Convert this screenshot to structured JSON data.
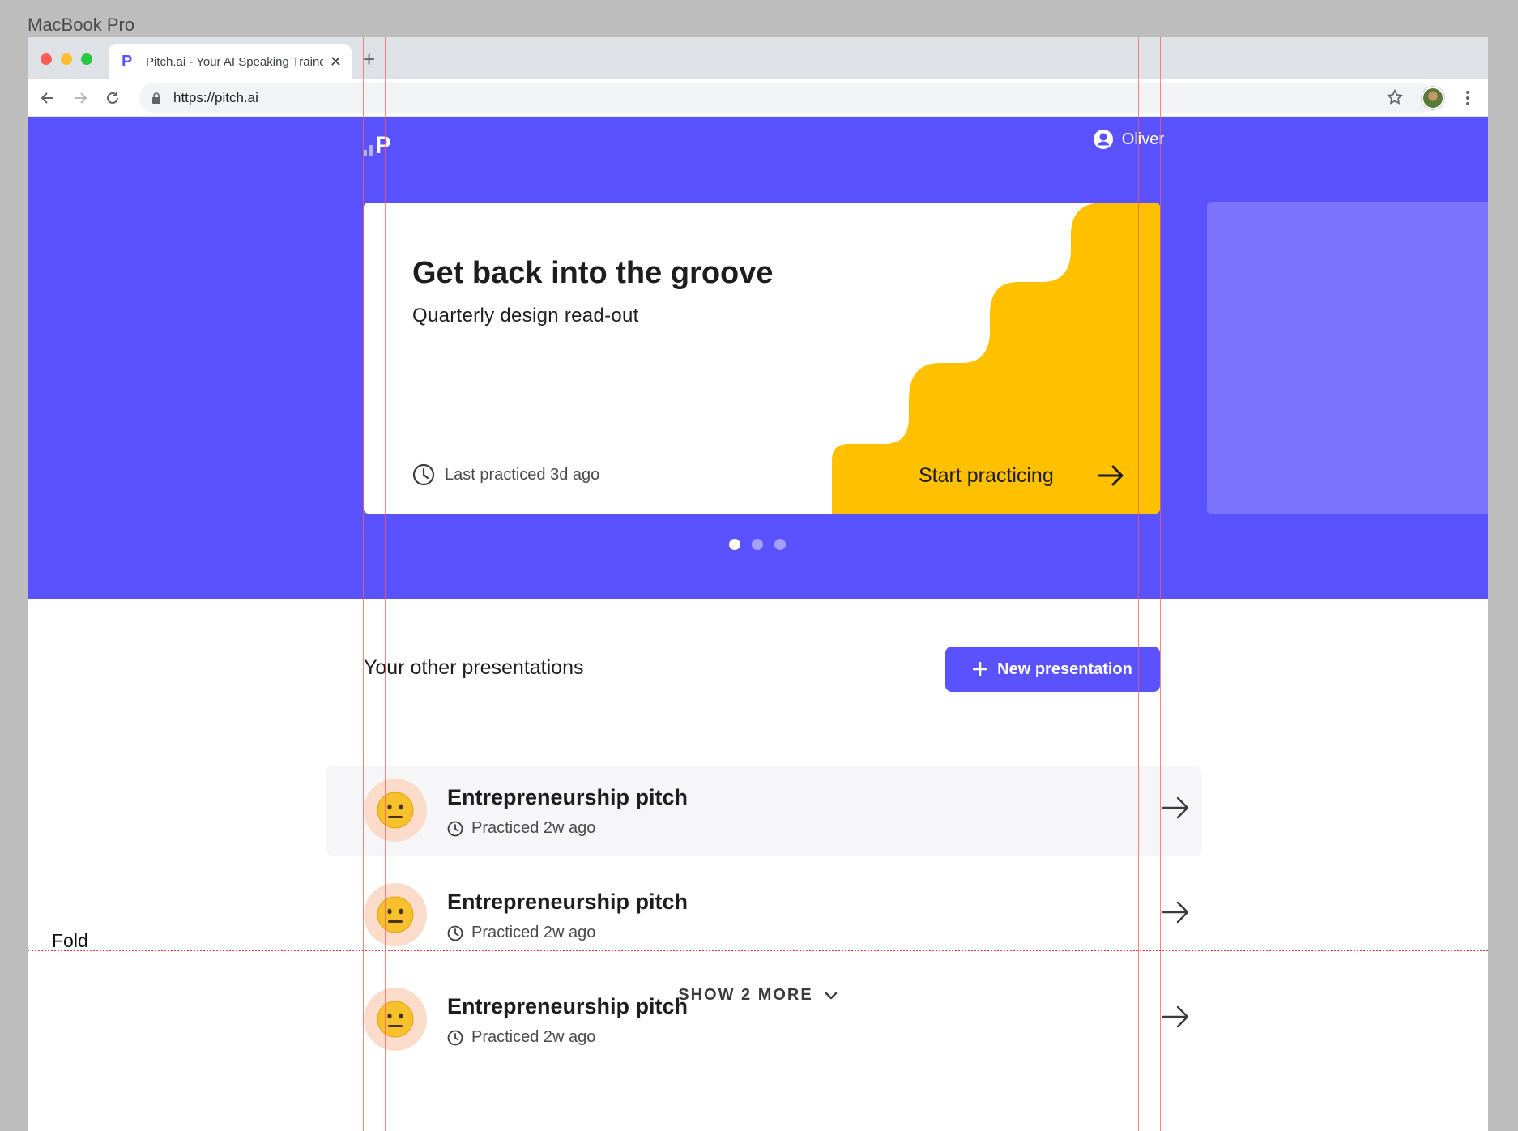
{
  "device_label": "MacBook Pro",
  "browser": {
    "tab_title": "Pitch.ai - Your AI Speaking Trainer",
    "tab_favicon": "P",
    "new_tab_symbol": "+",
    "close_symbol": "✕",
    "url": "https://pitch.ai"
  },
  "header": {
    "logo_letter": "P",
    "user_name": "Oliver"
  },
  "hero_card": {
    "title": "Get back into the groove",
    "subtitle": "Quarterly design read-out",
    "last_practiced": "Last practiced 3d ago",
    "cta_label": "Start practicing",
    "carousel_total": 3,
    "carousel_active": 1
  },
  "section": {
    "title": "Your other presentations",
    "new_button_label": "New presentation"
  },
  "presentations": [
    {
      "title": "Entrepreneurship pitch",
      "meta": "Practiced 2w ago",
      "emoji": "neutral-face-icon"
    },
    {
      "title": "Entrepreneurship pitch",
      "meta": "Practiced 2w ago",
      "emoji": "neutral-face-icon"
    },
    {
      "title": "Entrepreneurship pitch",
      "meta": "Practiced 2w ago",
      "emoji": "neutral-face-icon"
    }
  ],
  "show_more_label": "SHOW 2 MORE",
  "fold_label": "Fold",
  "colors": {
    "brand": "#5a52ff",
    "accent_yellow": "#ffc000",
    "next_card": "#7c74ff",
    "guide_lines": "#ff5a5a"
  }
}
